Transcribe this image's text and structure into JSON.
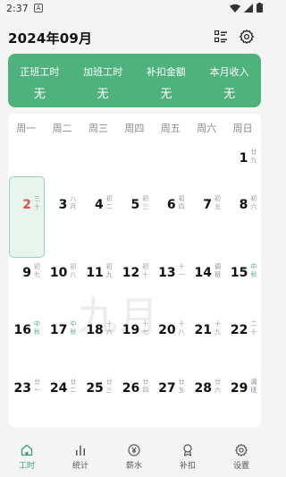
{
  "status_bar": {
    "time": "2:37",
    "notification": "A"
  },
  "header": {
    "title": "2024年09月"
  },
  "summary": [
    {
      "label": "正班工时",
      "value": "无"
    },
    {
      "label": "加班工时",
      "value": "无"
    },
    {
      "label": "补扣金额",
      "value": "无"
    },
    {
      "label": "本月收入",
      "value": "无"
    }
  ],
  "weekdays": [
    "周一",
    "周二",
    "周三",
    "周四",
    "周五",
    "周六",
    "周日"
  ],
  "watermark": "九月",
  "days": [
    {
      "n": "1",
      "lunar": "廿九",
      "type": ""
    },
    {
      "n": "2",
      "lunar": "三十",
      "type": "",
      "today": true
    },
    {
      "n": "3",
      "lunar": "八月",
      "type": ""
    },
    {
      "n": "4",
      "lunar": "初二",
      "type": ""
    },
    {
      "n": "5",
      "lunar": "初三",
      "type": ""
    },
    {
      "n": "6",
      "lunar": "初四",
      "type": ""
    },
    {
      "n": "7",
      "lunar": "初五",
      "type": ""
    },
    {
      "n": "8",
      "lunar": "初六",
      "type": ""
    },
    {
      "n": "9",
      "lunar": "初七",
      "type": ""
    },
    {
      "n": "10",
      "lunar": "初八",
      "type": ""
    },
    {
      "n": "11",
      "lunar": "初九",
      "type": ""
    },
    {
      "n": "12",
      "lunar": "初十",
      "type": ""
    },
    {
      "n": "13",
      "lunar": "十一",
      "type": ""
    },
    {
      "n": "14",
      "lunar": "调班",
      "type": "shift"
    },
    {
      "n": "15",
      "lunar": "中秋",
      "type": "hol"
    },
    {
      "n": "16",
      "lunar": "中秋",
      "type": "hol"
    },
    {
      "n": "17",
      "lunar": "中秋",
      "type": "hol"
    },
    {
      "n": "18",
      "lunar": "十六",
      "type": ""
    },
    {
      "n": "19",
      "lunar": "十七",
      "type": ""
    },
    {
      "n": "20",
      "lunar": "十八",
      "type": ""
    },
    {
      "n": "21",
      "lunar": "十九",
      "type": ""
    },
    {
      "n": "22",
      "lunar": "二十",
      "type": ""
    },
    {
      "n": "23",
      "lunar": "廿一",
      "type": ""
    },
    {
      "n": "24",
      "lunar": "廿二",
      "type": ""
    },
    {
      "n": "25",
      "lunar": "廿三",
      "type": ""
    },
    {
      "n": "26",
      "lunar": "廿四",
      "type": ""
    },
    {
      "n": "27",
      "lunar": "廿五",
      "type": ""
    },
    {
      "n": "28",
      "lunar": "廿六",
      "type": ""
    },
    {
      "n": "29",
      "lunar": "调班",
      "type": "shift"
    }
  ],
  "tabs": [
    {
      "label": "工时",
      "icon": "home-icon",
      "active": true
    },
    {
      "label": "统计",
      "icon": "bar-chart-icon",
      "active": false
    },
    {
      "label": "薪水",
      "icon": "yen-coin-icon",
      "active": false
    },
    {
      "label": "补扣",
      "icon": "medal-icon",
      "active": false
    },
    {
      "label": "设置",
      "icon": "gear-icon",
      "active": false
    }
  ],
  "colors": {
    "accent": "#4fb27d",
    "today": "#e05046",
    "shift": "#7b7fb0"
  }
}
